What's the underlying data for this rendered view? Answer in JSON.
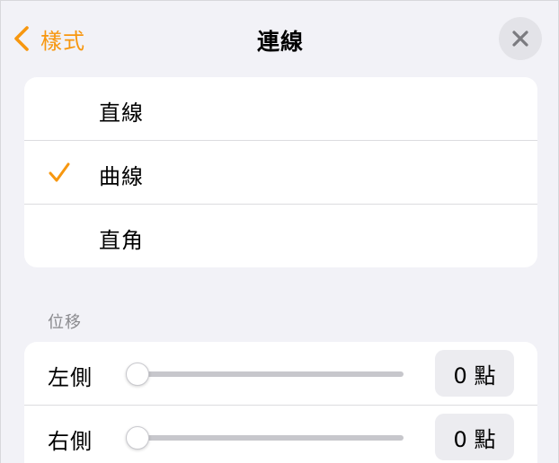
{
  "header": {
    "back_label": "樣式",
    "title": "連線",
    "close_icon": "close-icon",
    "accent_color": "#f7970f"
  },
  "line_types": [
    {
      "label": "直線",
      "selected": false
    },
    {
      "label": "曲線",
      "selected": true
    },
    {
      "label": "直角",
      "selected": false
    }
  ],
  "offset": {
    "section_label": "位移",
    "rows": [
      {
        "label": "左側",
        "value": "0 點",
        "level": 0
      },
      {
        "label": "右側",
        "value": "0 點",
        "level": 0
      }
    ]
  }
}
